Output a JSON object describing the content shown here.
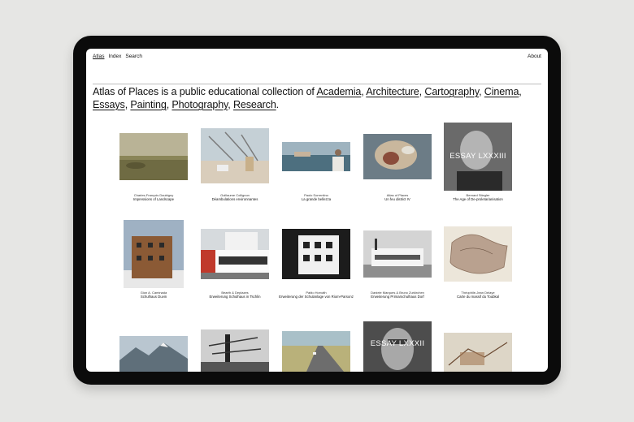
{
  "nav": {
    "items": [
      "Atlas",
      "Index",
      "Search"
    ],
    "about": "About"
  },
  "intro": {
    "lead": "Atlas of Places is a public educational collection of",
    "categories": [
      "Academia",
      "Architecture",
      "Cartography",
      "Cinema",
      "Essays",
      "Painting",
      "Photography",
      "Research"
    ],
    "and_word": "Academia, Architecture, Cartography, Cinema,",
    "line2_pre": "Essays, Painting, Photography, Research."
  },
  "grid": [
    [
      {
        "author": "Charles-François Daubigny",
        "title": "Impressions of Landscape",
        "icon": "landscape-painting"
      },
      {
        "author": "Guillaume Collignon",
        "title": "Déambulations environnantes",
        "icon": "construction-photo"
      },
      {
        "author": "Paolo Sorrentino",
        "title": "La grande bellezza",
        "icon": "film-still"
      },
      {
        "author": "Atlas of Places",
        "title": "Un feu district IV",
        "icon": "satellite-image"
      },
      {
        "author": "Bernard Stiegler",
        "title": "The Age of De-proletarianisation",
        "icon": "portrait",
        "overlay": "ESSAY LXXXIII"
      }
    ],
    [
      {
        "author": "Gion A. Caminada",
        "title": "Schulhaus Duvin",
        "icon": "wooden-house"
      },
      {
        "author": "Bearth & Deplazes",
        "title": "Erweiterung Schulhaus in Tschlin",
        "icon": "school-building"
      },
      {
        "author": "Pablo Horváth",
        "title": "Erweiterung der Schulanlage von Riom-Parsonz",
        "icon": "school-building-bw"
      },
      {
        "author": "Daniele Marques & Bruno Zurkirchen",
        "title": "Erweiterung Primarschulhaus Dorf",
        "icon": "school-building-bw"
      },
      {
        "author": "Théophile-Jean Delaye",
        "title": "Carte du massif du Toubkal",
        "icon": "map"
      }
    ],
    [
      {
        "author": "",
        "title": "",
        "icon": "mountain-photo"
      },
      {
        "author": "",
        "title": "",
        "icon": "industrial-photo"
      },
      {
        "author": "",
        "title": "",
        "icon": "road-photo"
      },
      {
        "author": "",
        "title": "",
        "icon": "portrait",
        "overlay": "ESSAY LXXXII"
      },
      {
        "author": "",
        "title": "",
        "icon": "drawing"
      }
    ]
  ]
}
